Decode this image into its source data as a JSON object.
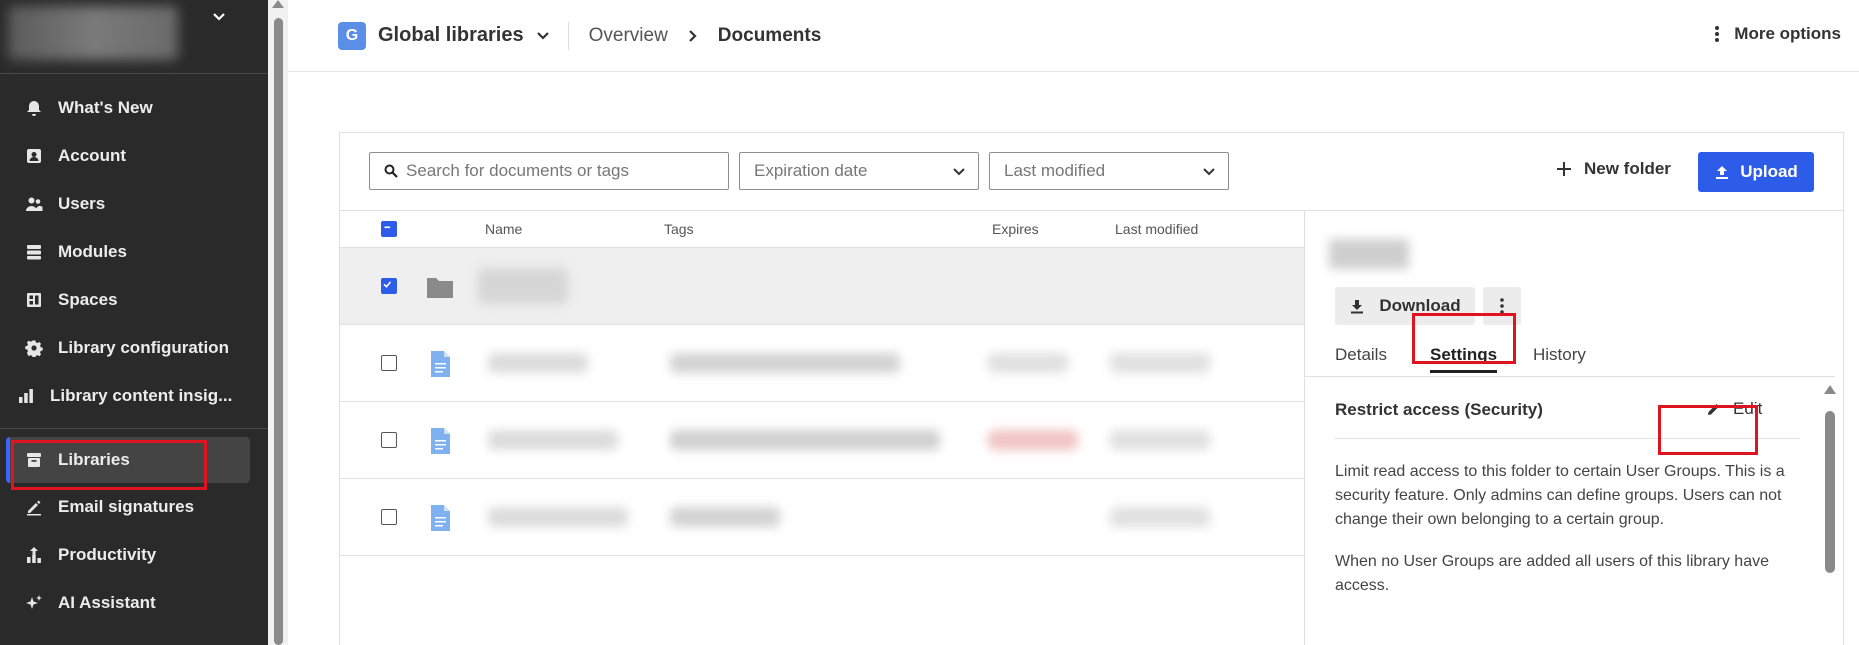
{
  "sidebar": {
    "items_top": [
      {
        "label": "What's New",
        "icon": "bell-icon"
      },
      {
        "label": "Account",
        "icon": "account-icon"
      },
      {
        "label": "Users",
        "icon": "users-icon"
      },
      {
        "label": "Modules",
        "icon": "modules-icon"
      },
      {
        "label": "Spaces",
        "icon": "spaces-icon"
      },
      {
        "label": "Library configuration",
        "icon": "gear-icon"
      },
      {
        "label": "Library content insig...",
        "icon": "bar-chart-icon"
      }
    ],
    "items_bottom": [
      {
        "label": "Libraries",
        "icon": "archive-icon",
        "active": true
      },
      {
        "label": "Email signatures",
        "icon": "signature-icon"
      },
      {
        "label": "Productivity",
        "icon": "productivity-icon"
      },
      {
        "label": "AI Assistant",
        "icon": "sparkle-icon"
      }
    ]
  },
  "header": {
    "library_badge": "G",
    "library_name": "Global libraries",
    "breadcrumb": [
      "Overview",
      "Documents"
    ],
    "more_options": "More options"
  },
  "toolbar": {
    "search_placeholder": "Search for documents or tags",
    "filter_expiration": "Expiration date",
    "filter_modified": "Last modified",
    "new_folder": "New folder",
    "upload": "Upload"
  },
  "table": {
    "columns": [
      "Name",
      "Tags",
      "Expires",
      "Last modified"
    ],
    "rows": [
      {
        "type": "folder",
        "selected": true
      },
      {
        "type": "document",
        "selected": false
      },
      {
        "type": "document",
        "selected": false
      },
      {
        "type": "document",
        "selected": false
      }
    ]
  },
  "panel": {
    "download": "Download",
    "tabs": [
      "Details",
      "Settings",
      "History"
    ],
    "active_tab": "Settings",
    "setting_title": "Restrict access (Security)",
    "edit": "Edit",
    "desc1": "Limit read access to this folder to certain User Groups. This is a security feature. Only admins can define groups. Users can not change their own belonging to a certain group.",
    "desc2": "When no User Groups are added all users of this library have access."
  },
  "colors": {
    "sidebar_bg": "#2a2a2a",
    "accent": "#2d5ce8",
    "highlight": "#e0141e"
  }
}
